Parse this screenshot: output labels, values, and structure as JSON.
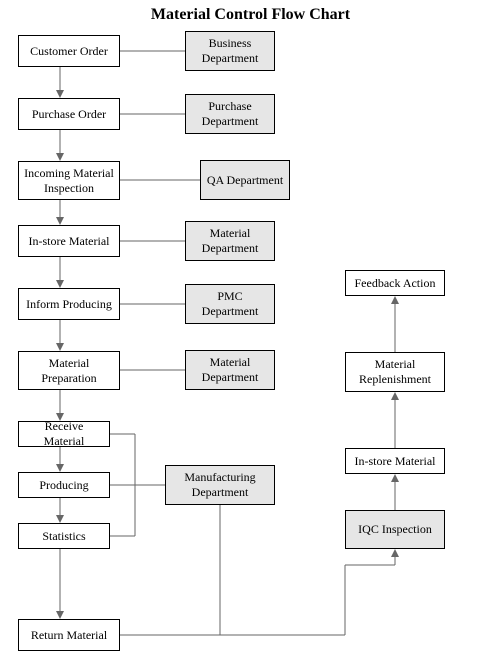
{
  "title": "Material Control Flow Chart",
  "left_steps": [
    "Customer Order",
    "Purchase Order",
    "Incoming Material Inspection",
    "In-store Material",
    "Inform Producing",
    "Material Preparation",
    "Receive Material",
    "Producing",
    "Statistics",
    "Return Material"
  ],
  "left_departments": [
    "Business Department",
    "Purchase Department",
    "QA Department",
    "Material Department",
    "PMC Department",
    "Material Department",
    "Manufacturing Department"
  ],
  "right_steps": [
    "IQC Inspection",
    "In-store Material",
    "Material Replenishment",
    "Feedback Action"
  ]
}
